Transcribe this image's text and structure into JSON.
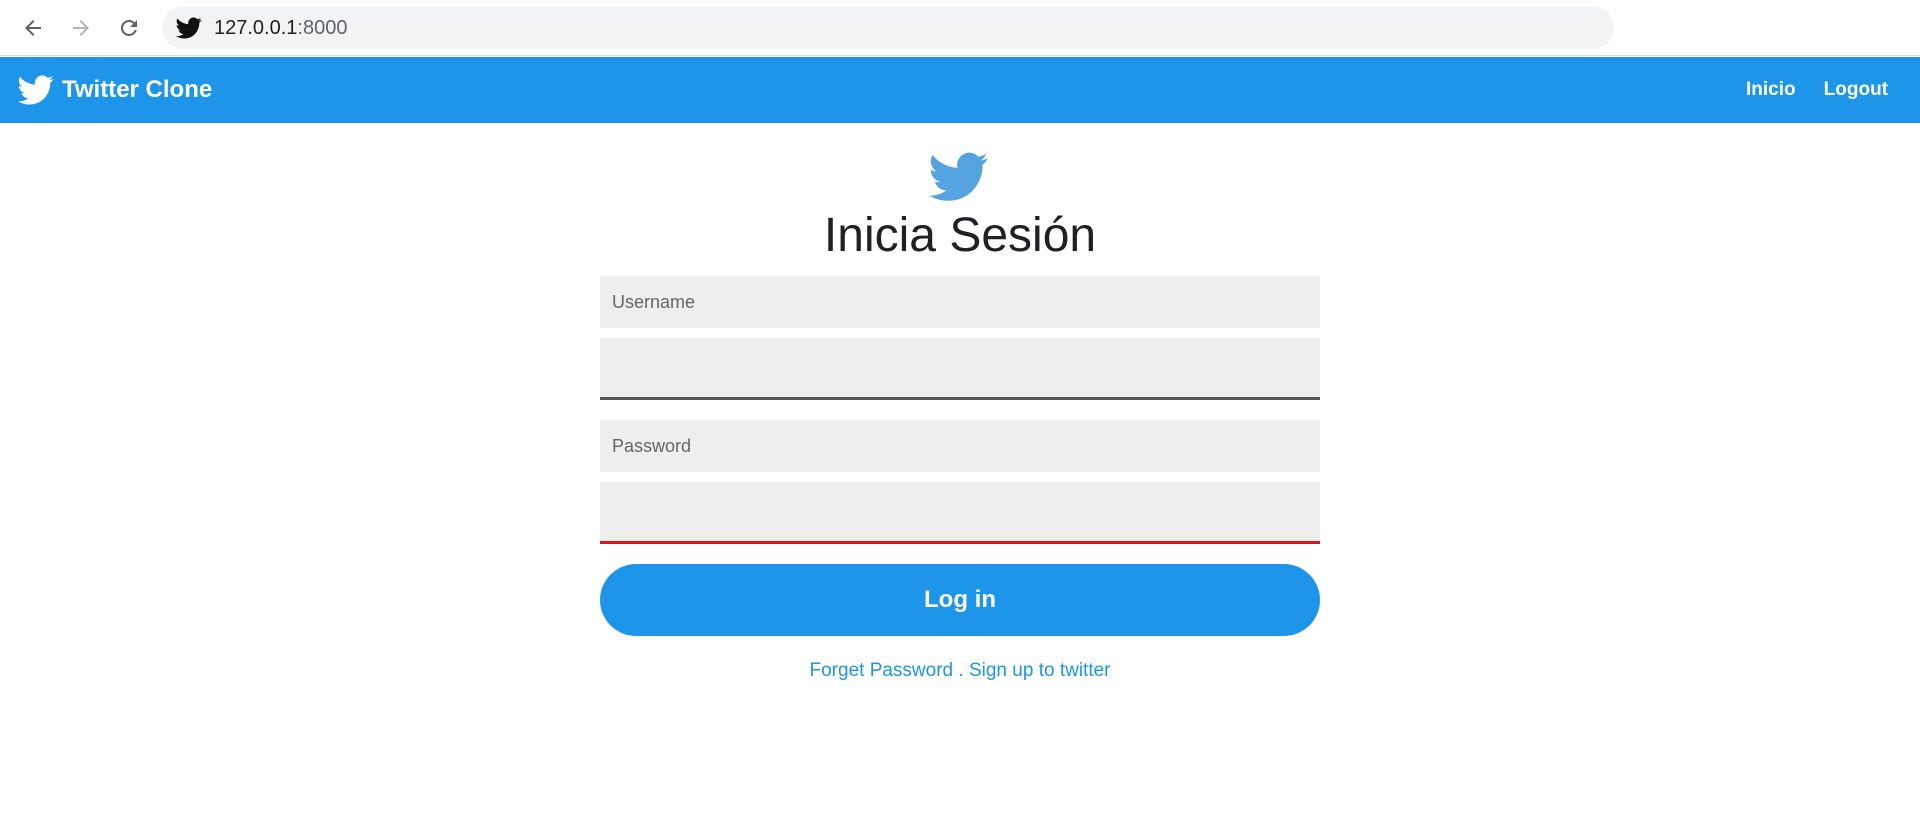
{
  "browser": {
    "url_host": "127.0.0.1",
    "url_port": ":8000",
    "back_icon": "arrow-left-icon",
    "forward_icon": "arrow-right-icon",
    "reload_icon": "reload-icon",
    "site_icon": "twitter-bird-icon"
  },
  "navbar": {
    "brand_title": "Twitter Clone",
    "links": [
      {
        "label": "Inicio"
      },
      {
        "label": "Logout"
      }
    ],
    "background": "#1d95e8"
  },
  "login": {
    "title": "Inicia Sesión",
    "username_label": "Username",
    "username_value": "",
    "password_label": "Password",
    "password_value": "",
    "submit_label": "Log in",
    "forgot_label": "Forget Password",
    "separator": " . ",
    "signup_label": "Sign up to twitter"
  },
  "colors": {
    "accent": "#1d95e8",
    "logo_blue": "#55a4df",
    "error_red": "#e2141c"
  }
}
